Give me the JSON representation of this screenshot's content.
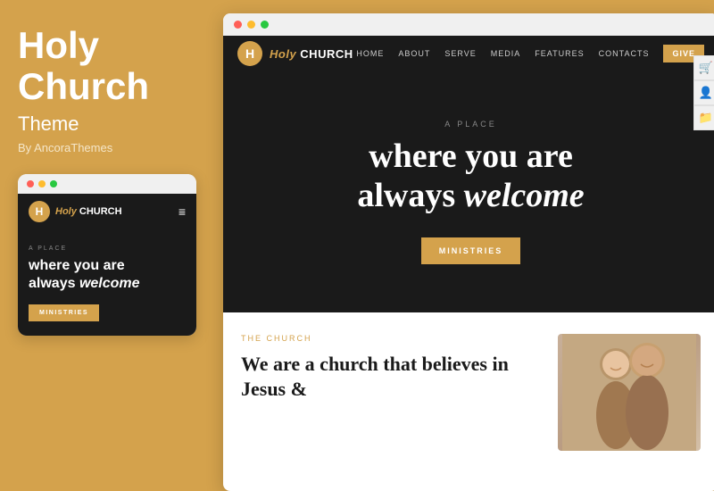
{
  "leftPanel": {
    "title_line1": "Holy",
    "title_line2": "Church",
    "subtitle": "Theme",
    "by": "By AncoraThemes"
  },
  "mobilePreview": {
    "windowDots": [
      "red",
      "yellow",
      "green"
    ],
    "logo": {
      "letter": "H",
      "text_italic": "Holy",
      "text_normal": "CHURCH"
    },
    "hamburger": "≡",
    "hero": {
      "a_place": "A PLACE",
      "headline": "where you are always welcome",
      "headline_italic": "welcome",
      "btn": "MINISTRIES"
    }
  },
  "sidebarIcons": {
    "icon1": "🛒",
    "icon2": "👤",
    "icon3": "📁"
  },
  "desktopPreview": {
    "windowDots": [
      "red",
      "yellow",
      "green"
    ],
    "nav": {
      "logo_letter": "H",
      "logo_italic": "Holy",
      "logo_normal": "CHURCH",
      "links": [
        "HOME",
        "ABOUT",
        "SERVE",
        "MEDIA",
        "FEATURES",
        "CONTACTS"
      ],
      "cta": "GIVE"
    },
    "rightIcons": [
      "🛒",
      "👤",
      "📁"
    ],
    "hero": {
      "a_place": "A PLACE",
      "headline_line1": "where you are",
      "headline_line2": "always welcome",
      "headline_italic": "welcome",
      "btn": "MINISTRIES"
    },
    "content": {
      "section_label": "THE CHURCH",
      "heading": "We are a church that believes in Jesus &"
    }
  }
}
